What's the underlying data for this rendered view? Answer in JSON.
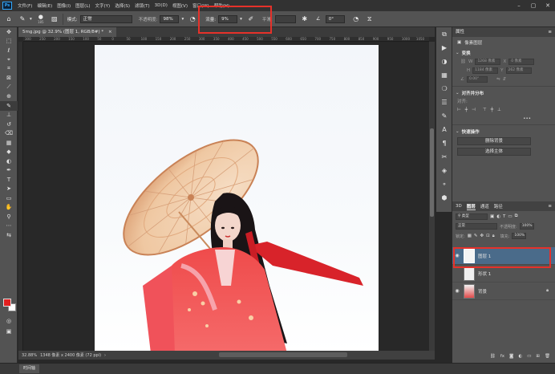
{
  "menubar": {
    "logo": "Ps",
    "items": [
      "文件(F)",
      "编辑(E)",
      "图像(I)",
      "图层(L)",
      "文字(Y)",
      "选择(S)",
      "滤镜(T)",
      "3D(D)",
      "视图(V)",
      "窗口(W)",
      "帮助(H)"
    ]
  },
  "options": {
    "brush_size": "185",
    "mode_label": "模式:",
    "mode_value": "正常",
    "opacity_label": "不透明度:",
    "opacity_value": "98%",
    "flow_label": "流量:",
    "flow_value": "9%",
    "smooth_label": "平滑:",
    "smooth_value": "",
    "angle_value": "0°"
  },
  "document": {
    "tab_title": "5mg.jpg @ 32.9% (图层 1, RGB/8#) *",
    "ruler_ticks": [
      "300",
      "250",
      "200",
      "150",
      "100",
      "50",
      "0",
      "50",
      "100",
      "150",
      "200",
      "250",
      "300",
      "350",
      "400",
      "450",
      "500",
      "550",
      "600",
      "650",
      "700",
      "750",
      "800",
      "850",
      "900",
      "950",
      "1000",
      "1050"
    ],
    "zoom": "32.88%",
    "size_info": "1348 像素 x 2400 像素 (72 ppi)"
  },
  "timeline": {
    "label": "时间轴"
  },
  "properties": {
    "header": "属性",
    "kind": "像素图层",
    "transform": {
      "title": "变换",
      "w_label": "W",
      "w_value": "1268 像素",
      "h_label": "H",
      "h_value": "1184 像素",
      "x_label": "X",
      "x_value": "0 像素",
      "y_label": "Y",
      "y_value": "262 像素",
      "angle_value": "0.00°"
    },
    "align": {
      "title": "对齐并分布",
      "sub": "对齐:"
    },
    "quick": {
      "title": "快速操作",
      "btn_remove_bg": "删除背景",
      "btn_select_subject": "选择主体"
    }
  },
  "layers": {
    "tabs": [
      "3D",
      "图层",
      "通道",
      "路径"
    ],
    "active_tab": "图层",
    "filter_label": "类型",
    "blend_mode": "正常",
    "opacity_label": "不透明度:",
    "opacity_value": "100%",
    "lock_label": "锁定:",
    "fill_label": "填充:",
    "fill_value": "100%",
    "items": [
      {
        "name": "图层 1",
        "selected": true
      },
      {
        "name": "形状 1",
        "selected": false
      },
      {
        "name": "背景",
        "selected": false
      }
    ],
    "footer_icons": [
      "link-icon",
      "fx-icon",
      "mask-icon",
      "adjust-icon",
      "group-icon",
      "new-layer-icon",
      "trash-icon"
    ]
  },
  "colors": {
    "foreground": "#e21f1f",
    "background": "#ffffff",
    "highlight": "#e5312a"
  }
}
